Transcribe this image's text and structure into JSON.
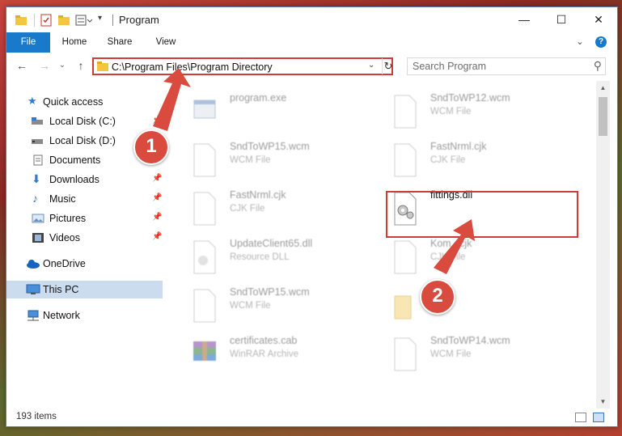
{
  "window": {
    "title": "Program",
    "controls": {
      "minimize": "—",
      "maximize": "☐",
      "close": "✕"
    }
  },
  "ribbon": {
    "tabs": [
      {
        "label": "File"
      },
      {
        "label": "Home"
      },
      {
        "label": "Share"
      },
      {
        "label": "View"
      }
    ],
    "expand_icon": "⌄",
    "help_icon": "?"
  },
  "navigation": {
    "back": "←",
    "forward": "→",
    "recent": "⌄",
    "up": "↑",
    "address": "C:\\Program Files\\Program Directory",
    "address_drop": "⌄",
    "refresh": "↻",
    "search_placeholder": "Search Program",
    "search_icon": "⚲"
  },
  "sidebar": {
    "items": [
      {
        "label": "Quick access",
        "icon": "star-icon"
      },
      {
        "label": "Local Disk (C:)",
        "icon": "drive-icon"
      },
      {
        "label": "Local Disk (D:)",
        "icon": "drive-icon"
      },
      {
        "label": "Documents",
        "icon": "documents-icon"
      },
      {
        "label": "Downloads",
        "icon": "download-icon"
      },
      {
        "label": "Music",
        "icon": "music-icon"
      },
      {
        "label": "Pictures",
        "icon": "pictures-icon"
      },
      {
        "label": "Videos",
        "icon": "videos-icon"
      },
      {
        "label": "OneDrive",
        "icon": "cloud-icon"
      },
      {
        "label": "This PC",
        "icon": "computer-icon"
      },
      {
        "label": "Network",
        "icon": "network-icon"
      }
    ]
  },
  "files": [
    {
      "name": "program.exe",
      "type": ""
    },
    {
      "name": "SndToWP12.wcm",
      "type": "WCM File"
    },
    {
      "name": "SndToWP15.wcm",
      "type": "WCM File"
    },
    {
      "name": "FastNrml.cjk",
      "type": "CJK File"
    },
    {
      "name": "FastNrml.cjk",
      "type": "CJK File"
    },
    {
      "name": "fittings.dll",
      "type": ""
    },
    {
      "name": "UpdateClient65.dll",
      "type": "Resource DLL"
    },
    {
      "name": "Kom...cjk",
      "type": "CJK File"
    },
    {
      "name": "SndToWP15.wcm",
      "type": "WCM File"
    },
    {
      "name": "",
      "type": ""
    },
    {
      "name": "certificates.cab",
      "type": "WinRAR Archive"
    },
    {
      "name": "SndToWP14.wcm",
      "type": "WCM File"
    }
  ],
  "annotations": {
    "badge1": "1",
    "badge2": "2",
    "arrow_color": "#d94a3f"
  },
  "status": {
    "items_count": "193 items"
  },
  "colors": {
    "accent": "#1979ca",
    "highlight": "#d33b3b",
    "selected": "#ccdcef"
  }
}
